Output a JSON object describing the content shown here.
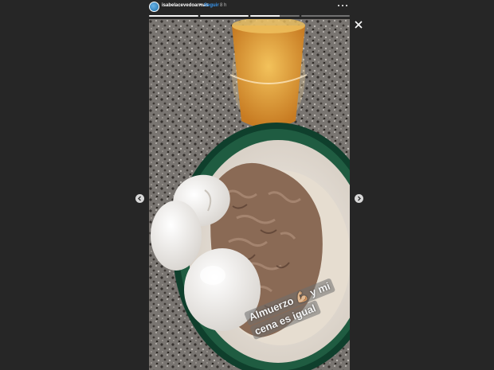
{
  "header": {
    "username": "isabelacevedoarmas",
    "separator": "•",
    "follow_label": "Seguir",
    "time": "8 h",
    "progress_segments": [
      {
        "state": "done"
      },
      {
        "state": "done"
      },
      {
        "state": "current"
      },
      {
        "state": "pending"
      }
    ]
  },
  "icons": {
    "more": "more-options-icon",
    "close": "close-icon",
    "prev": "chevron-left-icon",
    "next": "chevron-right-icon"
  },
  "story": {
    "caption_line1": "Almuerzo 💪🏼 y mi",
    "caption_line2": "cena es igual"
  },
  "colors": {
    "background": "#262626",
    "follow": "#3897f0",
    "plate_rim": "#0f3f2c",
    "beer": "#e6a237"
  }
}
